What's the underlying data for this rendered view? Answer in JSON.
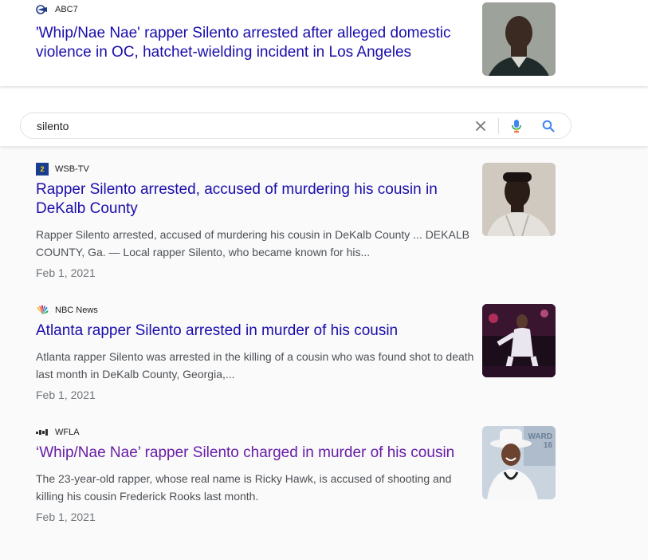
{
  "top_result": {
    "source": "ABC7",
    "title": "'Whip/Nae Nae' rapper Silento arrested after alleged domestic violence in OC, hatchet-wielding incident in Los Angeles"
  },
  "search": {
    "query": "silento",
    "clear_icon": "close-icon",
    "voice_icon": "mic-icon",
    "search_icon": "search-icon"
  },
  "results": [
    {
      "source": "WSB-TV",
      "title": "Rapper Silento arrested, accused of murdering his cousin in DeKalb County",
      "snippet": "Rapper Silento arrested, accused of murdering his cousin in DeKalb County ... DEKALB COUNTY, Ga. — Local rapper Silento, who became known for his...",
      "date": "Feb 1, 2021"
    },
    {
      "source": "NBC News",
      "title": "Atlanta rapper Silento arrested in murder of his cousin",
      "snippet": "Atlanta rapper Silento was arrested in the killing of a cousin who was found shot to death last month in DeKalb County, Georgia,...",
      "date": "Feb 1, 2021"
    },
    {
      "source": "WFLA",
      "title": "‘Whip/Nae Nae’ rapper Silento charged in murder of his cousin",
      "snippet": "The 23-year-old rapper, whose real name is Ricky Hawk, is accused of shooting and killing his cousin Frederick Rooks last month.",
      "date": "Feb 1, 2021",
      "thumb_text": "WARD 16"
    }
  ],
  "colors": {
    "link": "#1a0dab",
    "visited_link": "#681da8",
    "snippet": "#4d5156",
    "date": "#70757a"
  }
}
